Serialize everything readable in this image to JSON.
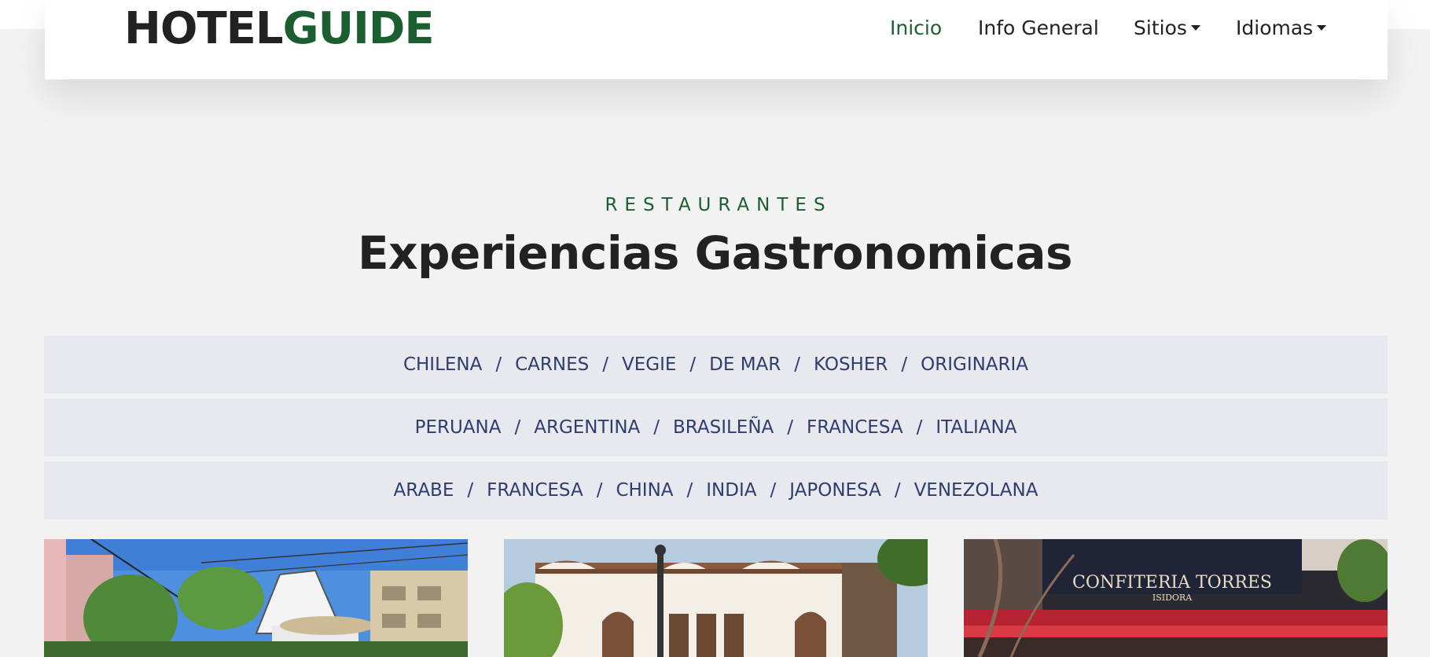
{
  "nav": {
    "logo_part1": "HOTEL",
    "logo_part2": "GUIDE",
    "items": [
      {
        "label": "Inicio",
        "active": true
      },
      {
        "label": "Info General"
      },
      {
        "label": "Sitios",
        "dropdown": true
      },
      {
        "label": "Idiomas",
        "dropdown": true
      }
    ]
  },
  "section": {
    "eyebrow": "RESTAURANTES",
    "title": "Experiencias Gastronomicas"
  },
  "categories": {
    "separator": "/",
    "rows": [
      [
        "CHILENA",
        "CARNES",
        "VEGIE",
        "DE MAR",
        "KOSHER",
        "ORIGINARIA"
      ],
      [
        "PERUANA",
        "ARGENTINA",
        "BRASILEÑA",
        "FRANCESA",
        "ITALIANA"
      ],
      [
        "ARABE",
        "FRANCESA",
        "CHINA",
        "INDIA",
        "JAPONESA",
        "VENEZOLANA"
      ]
    ]
  },
  "cards": [
    {
      "image": "restaurant-house-photo"
    },
    {
      "image": "colonial-building-photo"
    },
    {
      "image": "confiteria-photo",
      "sign_line1": "CONFITERIA TORRES",
      "sign_line2": "ISIDORA"
    }
  ],
  "colors": {
    "brand_green": "#1b5e30",
    "text_dark": "#222222",
    "category_text": "#2f3d6e",
    "category_bg": "#e8e9ee",
    "page_bg": "#f2f2f2"
  }
}
